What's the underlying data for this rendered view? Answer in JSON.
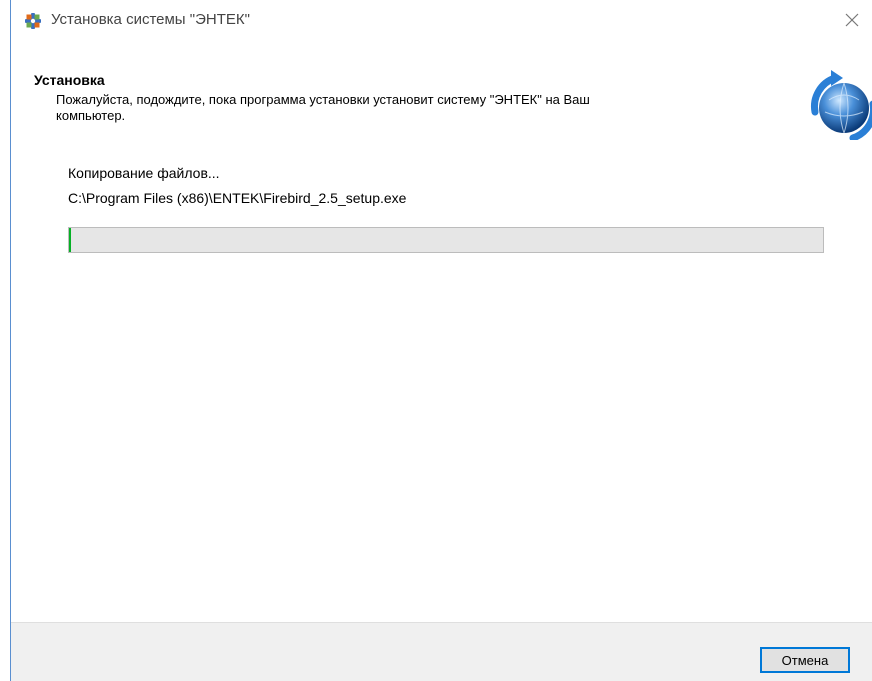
{
  "window": {
    "title": "Установка системы \"ЭНТЕК\"",
    "icons": {
      "app": "entek-app-icon",
      "close": "close-icon",
      "logo": "globe-refresh-icon"
    }
  },
  "header": {
    "title": "Установка",
    "description": "Пожалуйста, подождите, пока программа установки установит систему \"ЭНТЕК\" на Ваш компьютер."
  },
  "progress": {
    "status": "Копирование файлов...",
    "current_file": "C:\\Program Files (x86)\\ENTEK\\Firebird_2.5_setup.exe",
    "fraction": 0.003,
    "fill_color": "#06b025"
  },
  "footer": {
    "cancel_label": "Отмена"
  }
}
